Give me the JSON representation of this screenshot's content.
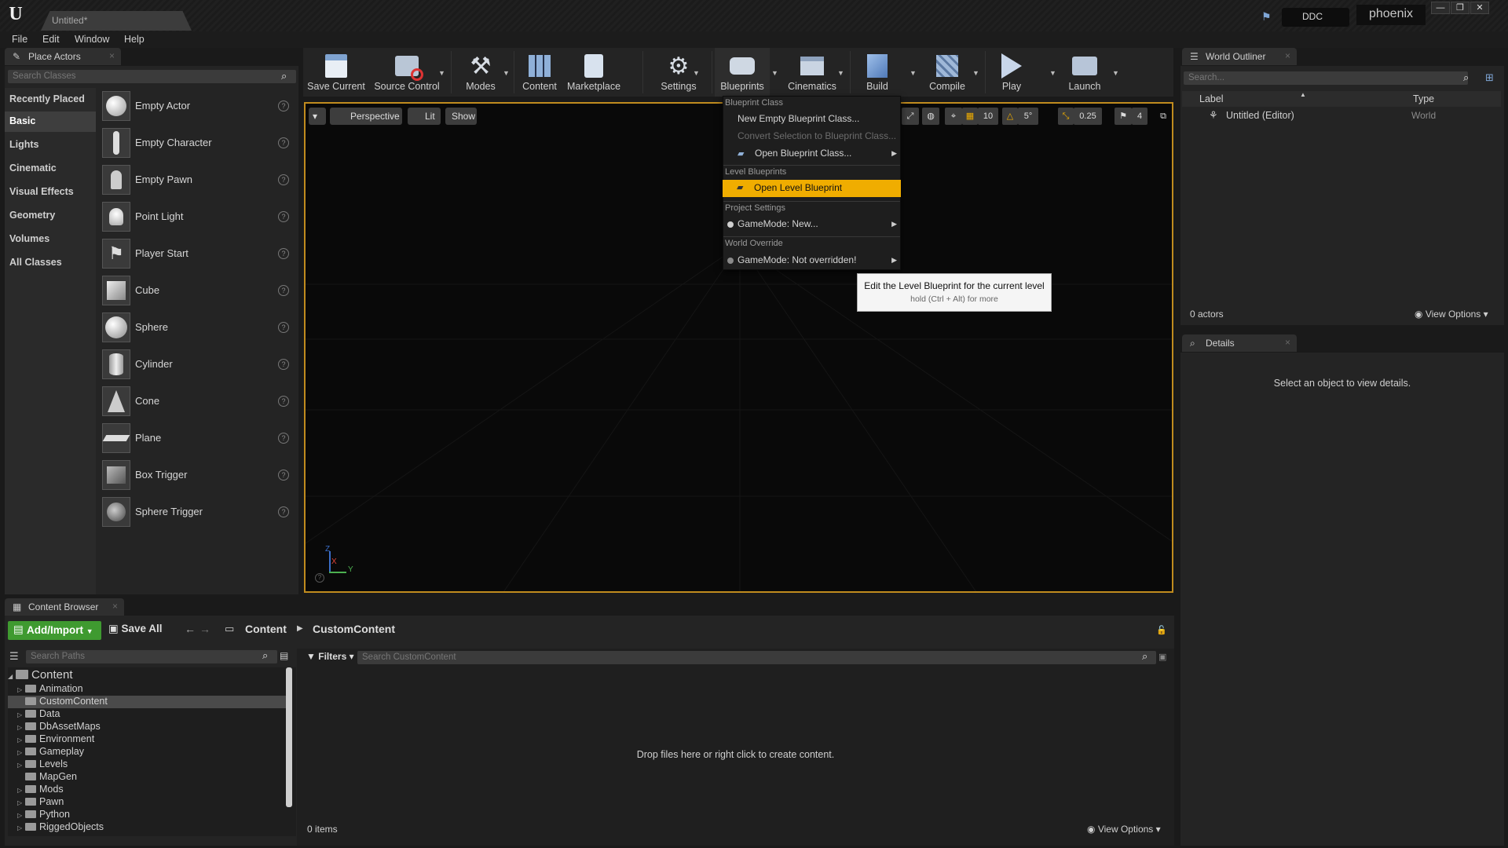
{
  "titlebar": {
    "doc_tab": "Untitled*",
    "ddc_label": "DDC",
    "user": "phoenix"
  },
  "menubar": [
    "File",
    "Edit",
    "Window",
    "Help"
  ],
  "place_actors": {
    "tab_title": "Place Actors",
    "search_placeholder": "Search Classes",
    "categories": [
      "Recently Placed",
      "Basic",
      "Lights",
      "Cinematic",
      "Visual Effects",
      "Geometry",
      "Volumes",
      "All Classes"
    ],
    "selected_category": "Basic",
    "actors": [
      "Empty Actor",
      "Empty Character",
      "Empty Pawn",
      "Point Light",
      "Player Start",
      "Cube",
      "Sphere",
      "Cylinder",
      "Cone",
      "Plane",
      "Box Trigger",
      "Sphere Trigger"
    ]
  },
  "toolbar": {
    "buttons": [
      "Save Current",
      "Source Control",
      "Modes",
      "Content",
      "Marketplace",
      "Settings",
      "Blueprints",
      "Cinematics",
      "Build",
      "Compile",
      "Play",
      "Launch"
    ]
  },
  "viewport": {
    "perspective": "Perspective",
    "lit": "Lit",
    "show": "Show",
    "grid_snap": "10",
    "rot_snap": "5°",
    "scale_snap": "0.25",
    "cam_speed": "4",
    "axis_x": "X",
    "axis_y": "Y",
    "axis_z": "Z"
  },
  "blueprints_menu": {
    "h1": "Blueprint Class",
    "new_empty": "New Empty Blueprint Class...",
    "convert": "Convert Selection to Blueprint Class...",
    "open_class": "Open Blueprint Class...",
    "h2": "Level Blueprints",
    "open_level": "Open Level Blueprint",
    "h3": "Project Settings",
    "gamemode_new": "GameMode: New...",
    "h4": "World Override",
    "gamemode_override": "GameMode: Not overridden!"
  },
  "tooltip": {
    "main": "Edit the Level Blueprint for the current level",
    "hint": "hold (Ctrl + Alt) for more"
  },
  "outliner": {
    "tab_title": "World Outliner",
    "search_placeholder": "Search...",
    "col_label": "Label",
    "col_type": "Type",
    "row_label": "Untitled (Editor)",
    "row_type": "World",
    "actor_count": "0 actors",
    "view_options": "View Options"
  },
  "details": {
    "tab_title": "Details",
    "empty_text": "Select an object to view details."
  },
  "content_browser": {
    "tab_title": "Content Browser",
    "add_import": "Add/Import",
    "save_all": "Save All",
    "crumb_root": "Content",
    "crumb_current": "CustomContent",
    "search_paths_placeholder": "Search Paths",
    "filters": "Filters",
    "search_content_placeholder": "Search CustomContent",
    "tree_root": "Content",
    "folders": [
      "Animation",
      "CustomContent",
      "Data",
      "DbAssetMaps",
      "Environment",
      "Gameplay",
      "Levels",
      "MapGen",
      "Mods",
      "Pawn",
      "Python",
      "RiggedObjects"
    ],
    "selected_folder": "CustomContent",
    "drop_hint": "Drop files here or right click to create content.",
    "item_count": "0 items",
    "view_options": "View Options"
  },
  "colors": {
    "accent_orange": "#f0ad00",
    "viewport_border": "#c08b1e",
    "add_import_green": "#3f9a30"
  }
}
